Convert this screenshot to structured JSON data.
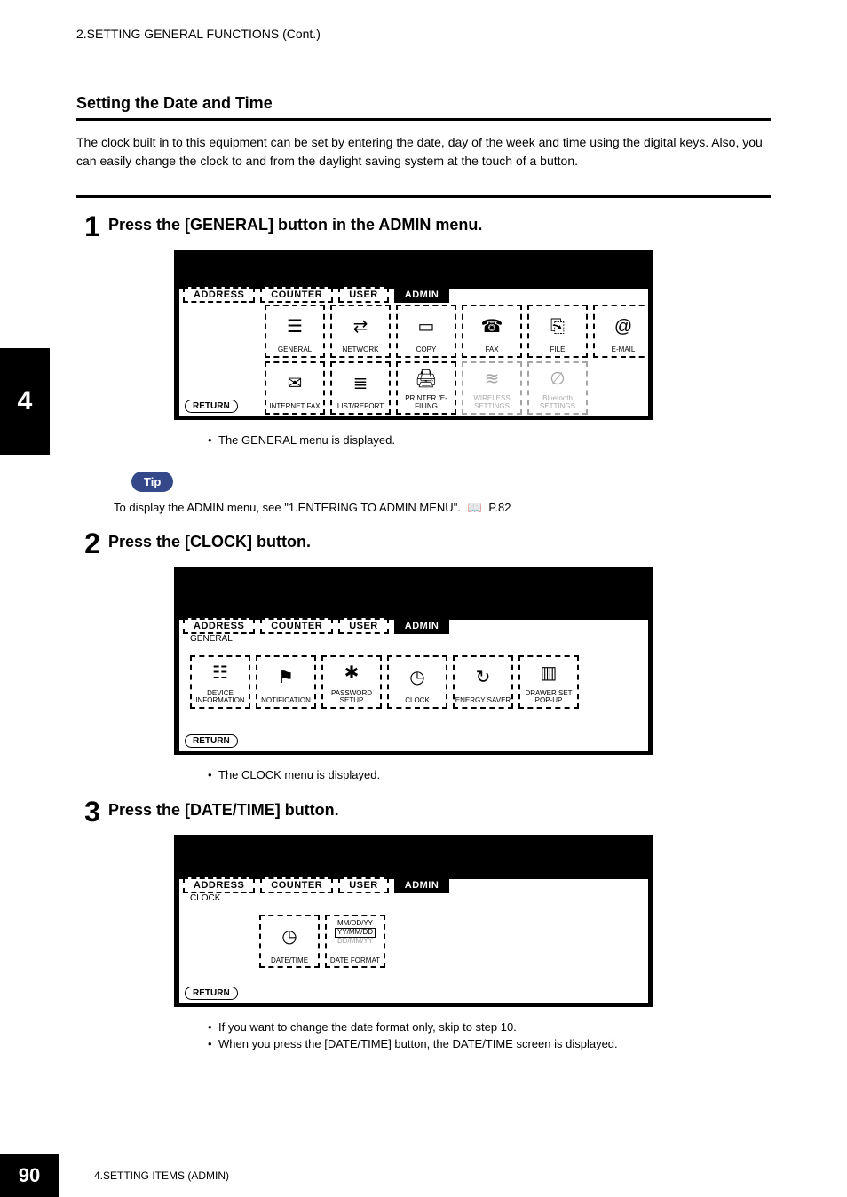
{
  "header": {
    "breadcrumb": "2.SETTING GENERAL FUNCTIONS (Cont.)"
  },
  "section": {
    "title": "Setting the Date and Time",
    "intro": "The clock built in to this equipment can be set by entering the date, day of the week and time using the digital keys.  Also, you can easily change the clock to and from the daylight saving system at the touch of a button."
  },
  "side_tab": "4",
  "steps": [
    {
      "num": "1",
      "title": "Press the [GENERAL] button in the ADMIN menu."
    },
    {
      "num": "2",
      "title": "Press the [CLOCK] button."
    },
    {
      "num": "3",
      "title": "Press the [DATE/TIME] button."
    }
  ],
  "screen1": {
    "tabs": [
      "ADDRESS",
      "COUNTER",
      "USER",
      "ADMIN"
    ],
    "tab_sel": 3,
    "row1": [
      "GENERAL",
      "NETWORK",
      "COPY",
      "FAX",
      "FILE",
      "E-MAIL"
    ],
    "row2": [
      "INTERNET FAX",
      "LIST/REPORT",
      "PRINTER /E-FILING",
      "WIRELESS SETTINGS",
      "Bluetooth SETTINGS"
    ],
    "return": "RETURN",
    "bullets": [
      "The GENERAL menu is displayed."
    ]
  },
  "tip": {
    "label": "Tip",
    "text_before": "To display the ADMIN menu, see \"1.ENTERING TO ADMIN MENU\".  ",
    "page_ref": "P.82"
  },
  "screen2": {
    "tabs": [
      "ADDRESS",
      "COUNTER",
      "USER",
      "ADMIN"
    ],
    "tab_sel": 3,
    "sublabel": "GENERAL",
    "row": [
      "DEVICE INFORMATION",
      "NOTIFICATION",
      "PASSWORD SETUP",
      "CLOCK",
      "ENERGY SAVER",
      "DRAWER SET POP-UP"
    ],
    "return": "RETURN",
    "bullets": [
      "The CLOCK menu is displayed."
    ]
  },
  "screen3": {
    "tabs": [
      "ADDRESS",
      "COUNTER",
      "USER",
      "ADMIN"
    ],
    "tab_sel": 3,
    "sublabel": "CLOCK",
    "row": [
      "DATE/TIME",
      "DATE FORMAT"
    ],
    "dateformat_opts": [
      "MM/DD/YY",
      "YY/MM/DD",
      "DD/MM/YY"
    ],
    "return": "RETURN",
    "bullets": [
      "If you want to change the date format only, skip to step 10.",
      "When you press the [DATE/TIME] button, the DATE/TIME screen is displayed."
    ]
  },
  "footer": {
    "page_num": "90",
    "chapter": "4.SETTING ITEMS (ADMIN)"
  }
}
